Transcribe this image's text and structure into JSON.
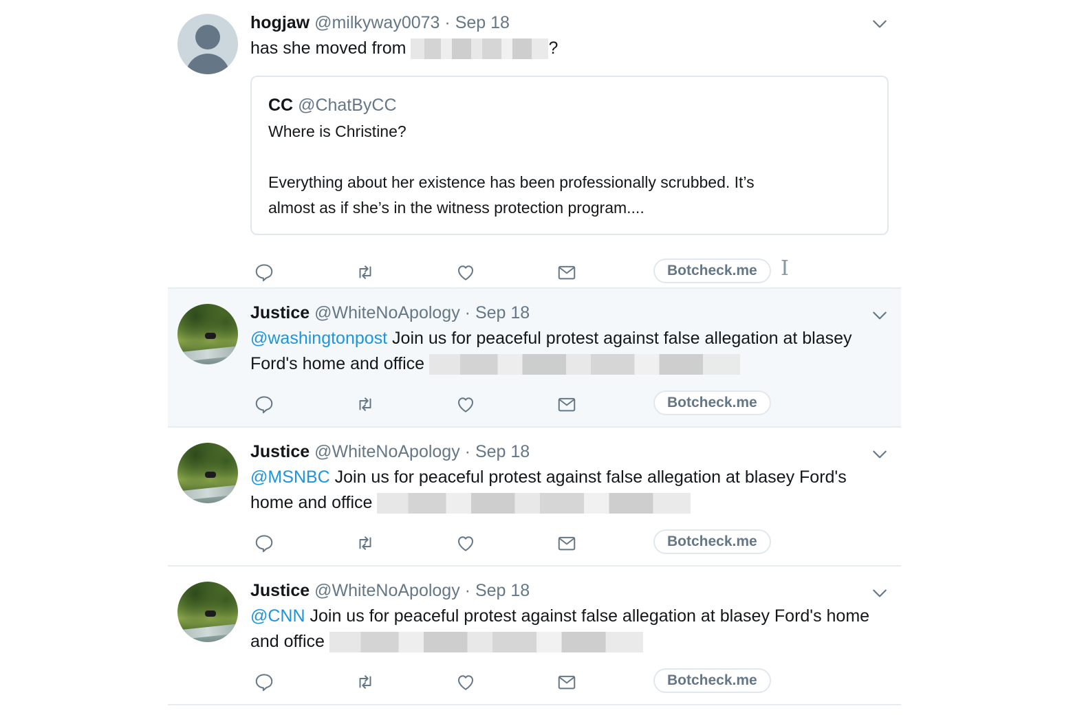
{
  "tweets": [
    {
      "name": "hogjaw",
      "handle": "@milkyway0073",
      "separator": "·",
      "date": "Sep 18",
      "text_before": "has she moved from",
      "text_after": "?",
      "avatar": "default-avatar",
      "quote": {
        "name": "CC",
        "handle": "@ChatByCC",
        "line1": "Where is Christine?",
        "line2": "Everything about her existence has been professionally scrubbed.  It’s",
        "line3": "almost as if she’s in the witness protection program...."
      },
      "botcheck": "Botcheck.me"
    },
    {
      "name": "Justice",
      "handle": "@WhiteNoApology",
      "separator": "·",
      "date": "Sep 18",
      "mention": "@washingtonpost",
      "line1": " Join us for peaceful protest against false allegation at blasey",
      "line2": "Ford's home and office",
      "avatar": "landscape-avatar",
      "botcheck": "Botcheck.me"
    },
    {
      "name": "Justice",
      "handle": "@WhiteNoApology",
      "separator": "·",
      "date": "Sep 18",
      "mention": "@MSNBC",
      "line1": " Join us for peaceful protest against false allegation at blasey Ford's",
      "line2": "home and office",
      "avatar": "landscape-avatar",
      "botcheck": "Botcheck.me"
    },
    {
      "name": "Justice",
      "handle": "@WhiteNoApology",
      "separator": "·",
      "date": "Sep 18",
      "mention": "@CNN",
      "line1": " Join us for peaceful protest against false allegation at blasey Ford's home",
      "line2": "and office",
      "avatar": "landscape-avatar",
      "botcheck": "Botcheck.me"
    }
  ],
  "actions": [
    "reply-icon",
    "retweet-icon",
    "like-icon",
    "direct-message-icon"
  ],
  "colors": {
    "mention": "#1b95e0",
    "secondary_text": "#657786",
    "highlight_background": "#f5f8fa",
    "divider": "#e6ecf0"
  },
  "cursor_icon": "text-cursor-icon"
}
